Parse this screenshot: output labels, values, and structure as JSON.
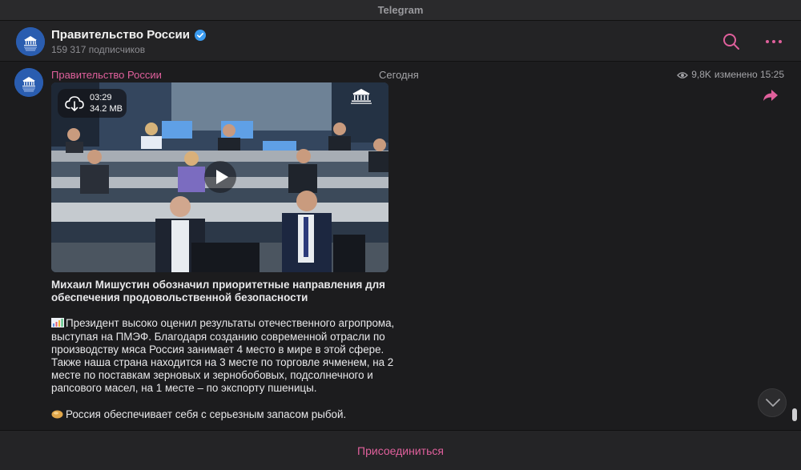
{
  "window": {
    "title": "Telegram"
  },
  "header": {
    "channel_name": "Правительство России",
    "subscribers": "159 317 подписчиков",
    "verified": true
  },
  "post": {
    "author": "Правительство России",
    "date_label": "Сегодня",
    "views": "9,8K",
    "edited_label": "изменено 15:25",
    "video": {
      "duration": "03:29",
      "size": "34.2 MB"
    },
    "title": "Михаил Мишустин обозначил приоритетные направления для обеспечения продовольственной безопасности",
    "paragraph1": "Президент высоко оценил результаты отечественного агропрома, выступая на ПМЭФ. Благодаря созданию современной отрасли по производству мяса Россия занимает 4 место в мире в этой сфере. Также наша страна находится на 3 месте по торговле ячменем, на 2 месте по поставкам зерновых и зернобобовых, подсолнечного и рапсового масел, на 1 месте – по экспорту пшеницы.",
    "paragraph2": "Россия обеспечивает себя с серьезным запасом рыбой."
  },
  "footer": {
    "join_label": "Присоединиться"
  },
  "icons": {
    "search": "search-icon",
    "more": "more-icon",
    "share": "share-icon",
    "eye": "eye-icon",
    "download": "cloud-download-icon",
    "play": "play-icon",
    "scroll_down": "chevron-down-icon",
    "verified": "verified-badge-icon"
  },
  "colors": {
    "accent": "#e0609c",
    "verified": "#3a9bf0",
    "background": "#1c1c1e"
  }
}
